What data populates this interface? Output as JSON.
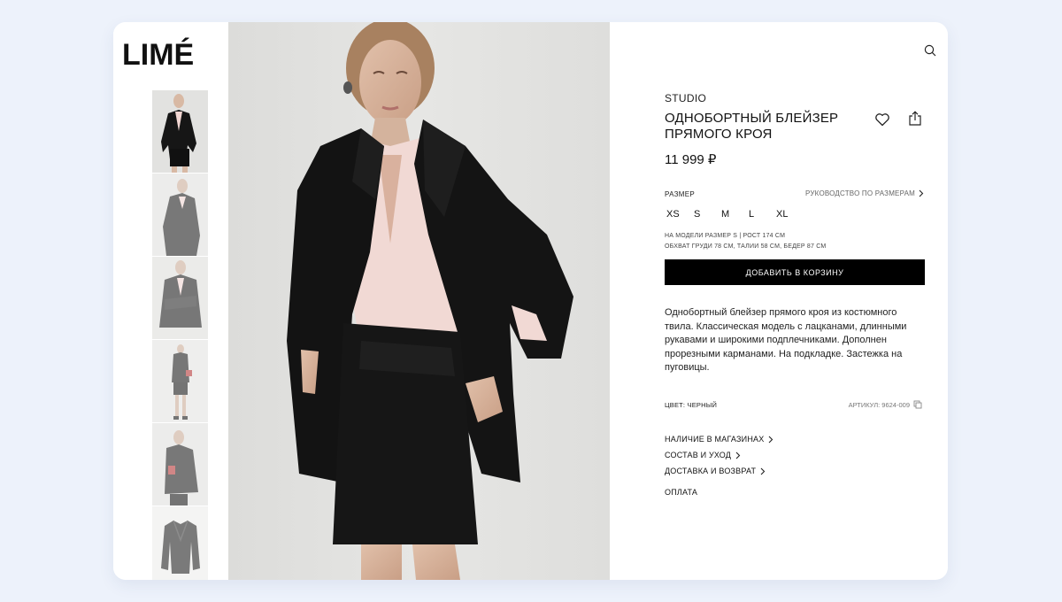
{
  "brand_logo": "LIMÉ",
  "gallery": {
    "thumbnails": [
      "thumb-1",
      "thumb-2",
      "thumb-3",
      "thumb-4",
      "thumb-5",
      "thumb-6"
    ]
  },
  "product": {
    "collection": "STUDIO",
    "title": "ОДНОБОРТНЫЙ БЛЕЙЗЕР ПРЯМОГО КРОЯ",
    "price": "11 999 ₽",
    "size_label": "РАЗМЕР",
    "size_guide": "РУКОВОДСТВО ПО РАЗМЕРАМ",
    "sizes": [
      "XS",
      "S",
      "M",
      "L",
      "XL"
    ],
    "model_info_1": "НА МОДЕЛИ РАЗМЕР S | РОСТ 174 СМ",
    "model_info_2": "ОБХВАТ ГРУДИ 78 СМ, ТАЛИИ 58 СМ, БЕДЕР 87 СМ",
    "add_to_cart": "ДОБАВИТЬ В КОРЗИНУ",
    "description": "Однобортный блейзер прямого кроя из костюмного твила. Классическая модель с лацканами, длинными рукавами и широкими подплечниками. Дополнен прорезными карманами. На подкладке. Застежка на пуговицы.",
    "color": "ЦВЕТ: ЧЕРНЫЙ",
    "sku": "АРТИКУЛ: 9624-009"
  },
  "links": {
    "availability": "НАЛИЧИЕ В МАГАЗИНАХ",
    "composition": "СОСТАВ И УХОД",
    "delivery": "ДОСТАВКА И ВОЗВРАТ",
    "payment": "ОПЛАТА"
  },
  "icons": {
    "search": "search-icon",
    "favorite": "heart-icon",
    "share": "share-icon",
    "copy": "copy-icon",
    "chevron": "chevron-right-icon"
  },
  "colors": {
    "background": "#edf2fb",
    "button": "#000000",
    "text": "#111111"
  }
}
